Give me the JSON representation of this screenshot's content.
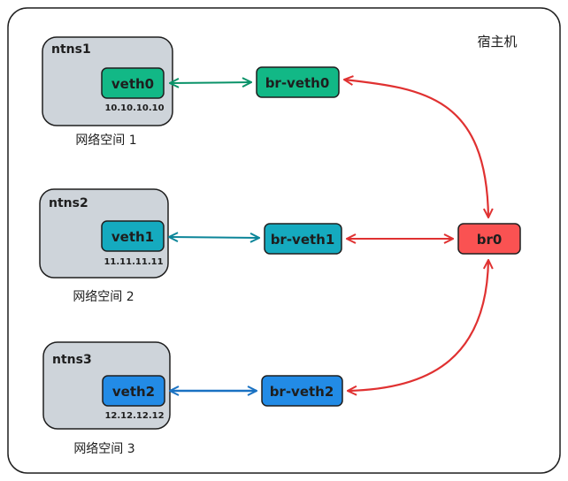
{
  "host": {
    "label": "宿主机"
  },
  "namespaces": [
    {
      "name": "ntns1",
      "veth": "veth0",
      "ip": "10.10.10.10",
      "caption": "网络空间 1",
      "bridge_port": "br-veth0",
      "color": "#12b886"
    },
    {
      "name": "ntns2",
      "veth": "veth1",
      "ip": "11.11.11.11",
      "caption": "网络空间 2",
      "bridge_port": "br-veth1",
      "color": "#15aabf"
    },
    {
      "name": "ntns3",
      "veth": "veth2",
      "ip": "12.12.12.12",
      "caption": "网络空间 3",
      "bridge_port": "br-veth2",
      "color": "#228be6"
    }
  ],
  "bridge": {
    "name": "br0",
    "color": "#fa5252"
  },
  "colors": {
    "ns_fill": "#ced4da",
    "stroke": "#1e1e1e",
    "link1": "#099268",
    "link2": "#0c8599",
    "link3": "#1971c2",
    "bridge_link": "#e03131"
  }
}
